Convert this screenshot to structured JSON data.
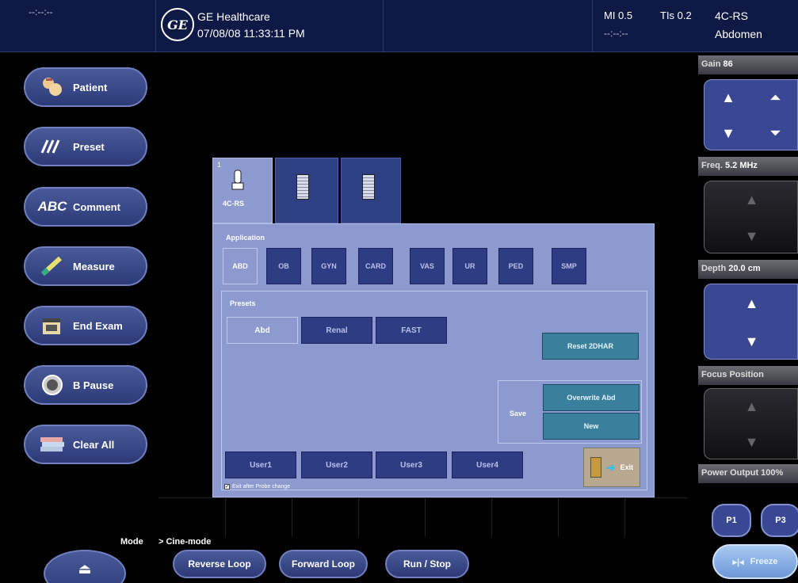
{
  "top": {
    "left_status": "--:--:--",
    "brand": "GE Healthcare",
    "datetime": "07/08/08 11:33:11 PM",
    "mi": "MI 0.5",
    "tis": "TIs 0.2",
    "probe": "4C-RS",
    "application": "Abdomen",
    "time_placeholder": "--:--:--",
    "logo_text": "GE"
  },
  "left_buttons": [
    {
      "label": "Patient",
      "icon": "patient-icon"
    },
    {
      "label": "Preset",
      "icon": "preset-icon"
    },
    {
      "label": "Comment",
      "icon": "comment-icon"
    },
    {
      "label": "Measure",
      "icon": "measure-icon"
    },
    {
      "label": "End Exam",
      "icon": "end-exam-icon"
    },
    {
      "label": "B Pause",
      "icon": "pause-icon"
    },
    {
      "label": "Clear All",
      "icon": "clear-all-icon"
    }
  ],
  "abc_glyph": "ABC",
  "dialog": {
    "tabs": [
      {
        "number": "1",
        "label": "4C-RS"
      }
    ],
    "application_title": "Application",
    "applications": [
      "ABD",
      "OB",
      "GYN",
      "CARD",
      "VAS",
      "UR",
      "PED",
      "SMP"
    ],
    "presets_title": "Presets",
    "presets": [
      "Abd",
      "Renal",
      "FAST"
    ],
    "reset_label": "Reset 2DHAR",
    "save_label": "Save",
    "overwrite_label": "Overwrite Abd",
    "new_label": "New",
    "users": [
      "User1",
      "User2",
      "User3",
      "User4"
    ],
    "exit_label": "Exit",
    "exit_after_probe": "Exit after Probe change"
  },
  "right_panel": {
    "gain_label": "Gain",
    "gain_value": "86",
    "freq_label": "Freq.",
    "freq_value": "5.2 MHz",
    "depth_label": "Depth",
    "depth_value": "20.0 cm",
    "focus_label": "Focus Position",
    "power_label": "Power Output 100%",
    "p1": "P1",
    "p3": "P3",
    "freeze": "Freeze"
  },
  "bottom": {
    "mode_label": "Mode",
    "cine_mode": "> Cine-mode",
    "reverse_loop": "Reverse Loop",
    "forward_loop": "Forward Loop",
    "run_stop": "Run / Stop"
  },
  "colors": {
    "topbar": "#0e1a45",
    "button_blue": "#2c3a78",
    "dialog_bg": "#8c9ad0",
    "teal_button": "#3a7f9c"
  }
}
